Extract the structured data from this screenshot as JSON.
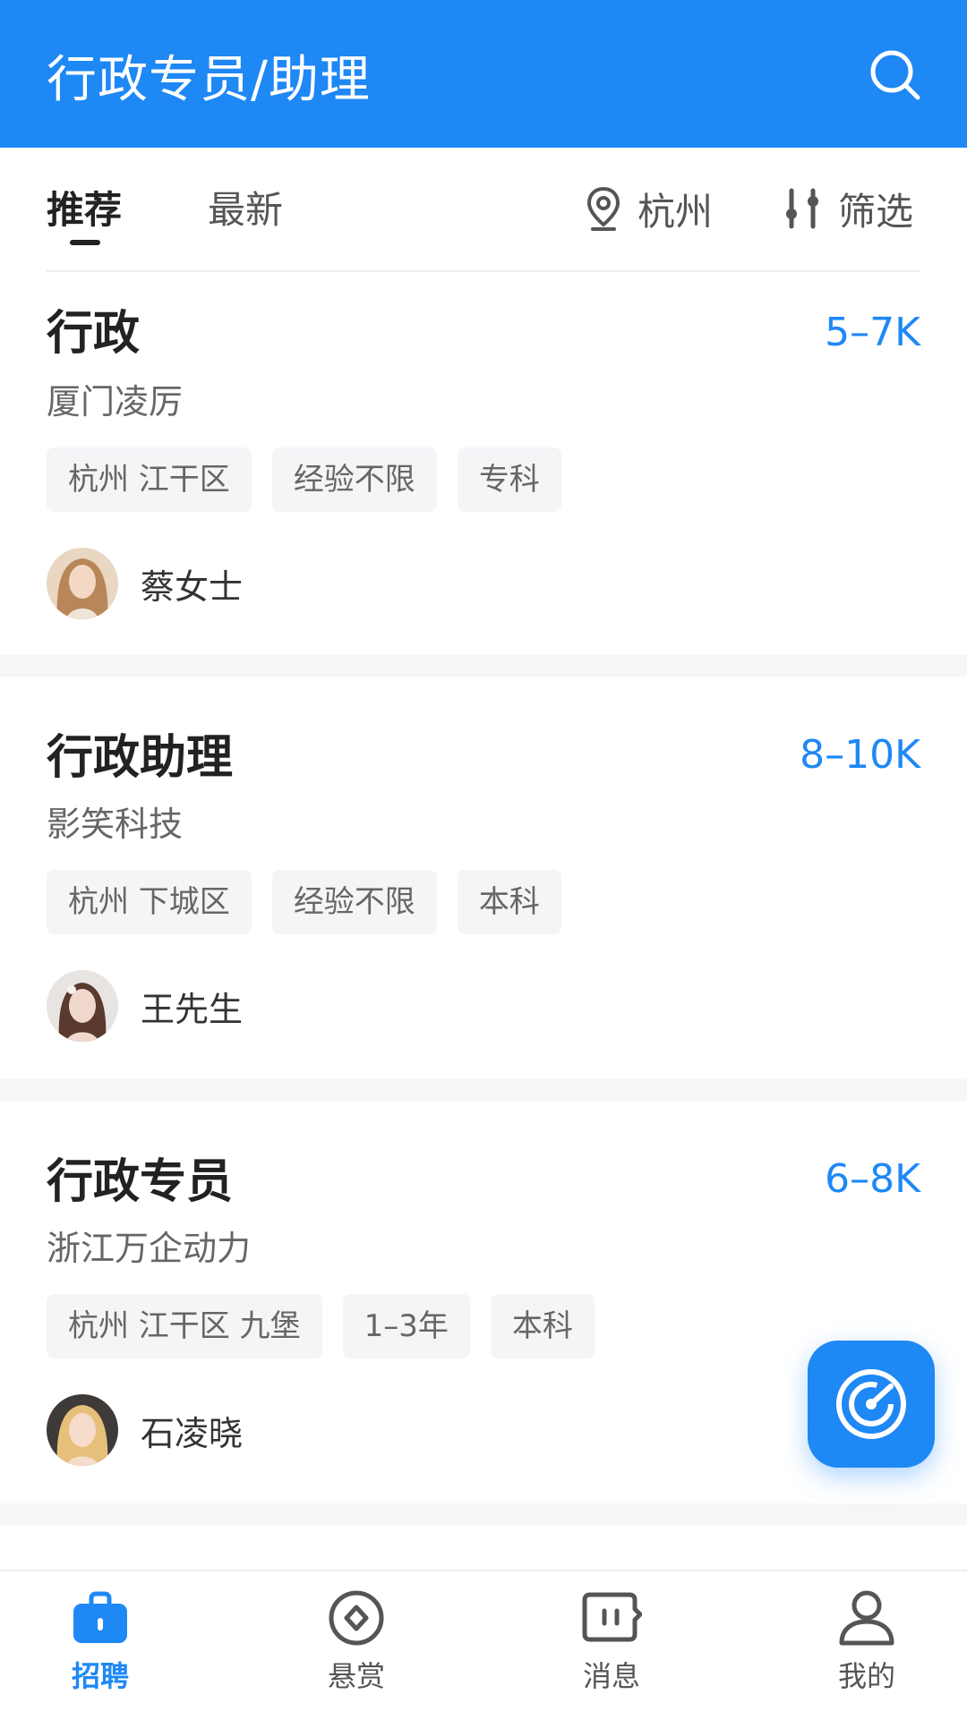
{
  "header": {
    "title": "行政专员/助理",
    "search_icon": "search-icon"
  },
  "tabs": {
    "recommended": "推荐",
    "latest": "最新",
    "location": "杭州",
    "filter": "筛选"
  },
  "jobs": [
    {
      "title": "行政",
      "salary": "5–7K",
      "company": "厦门凌厉",
      "tags": [
        "杭州 江干区",
        "经验不限",
        "专科"
      ],
      "recruiter": "蔡女士"
    },
    {
      "title": "行政助理",
      "salary": "8–10K",
      "company": "影笑科技",
      "tags": [
        "杭州 下城区",
        "经验不限",
        "本科"
      ],
      "recruiter": "王先生"
    },
    {
      "title": "行政专员",
      "salary": "6–8K",
      "company": "浙江万企动力",
      "tags": [
        "杭州 江干区 九堡",
        "1–3年",
        "本科"
      ],
      "recruiter": "石凌晓"
    }
  ],
  "bottom_nav": [
    {
      "label": "招聘",
      "icon": "briefcase-icon",
      "active": true
    },
    {
      "label": "悬赏",
      "icon": "reward-icon",
      "active": false
    },
    {
      "label": "消息",
      "icon": "message-icon",
      "active": false
    },
    {
      "label": "我的",
      "icon": "profile-icon",
      "active": false
    }
  ],
  "colors": {
    "primary": "#1e88f5",
    "tag_bg": "#f4f5f7",
    "text_dark": "#222222",
    "text_muted": "#666666"
  }
}
